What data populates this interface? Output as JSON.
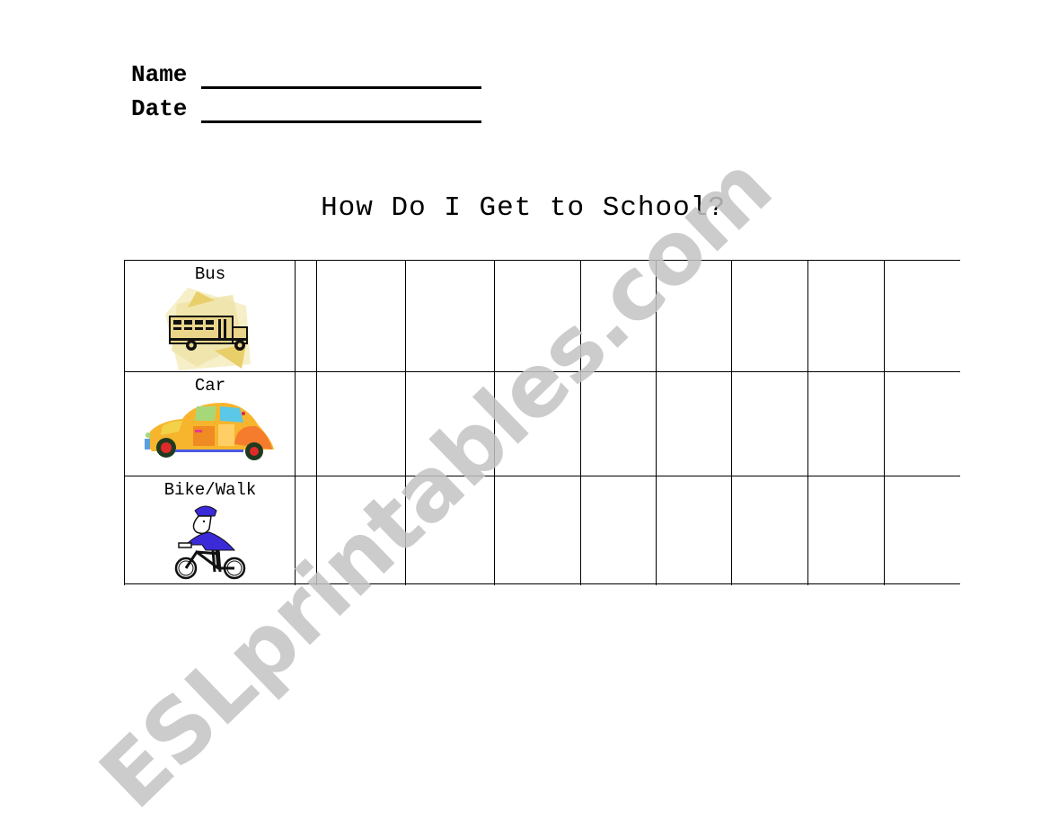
{
  "worksheet": {
    "name_label": "Name",
    "date_label": "Date",
    "title": "How Do I Get to School?",
    "rows": [
      {
        "label": "Bus",
        "icon": "school-bus-icon"
      },
      {
        "label": "Car",
        "icon": "car-icon"
      },
      {
        "label": "Bike/Walk",
        "icon": "cyclist-icon"
      }
    ],
    "tally_columns": 9
  },
  "watermark": {
    "text": "ESLprintables.com",
    "color": "#c4c4c4"
  }
}
